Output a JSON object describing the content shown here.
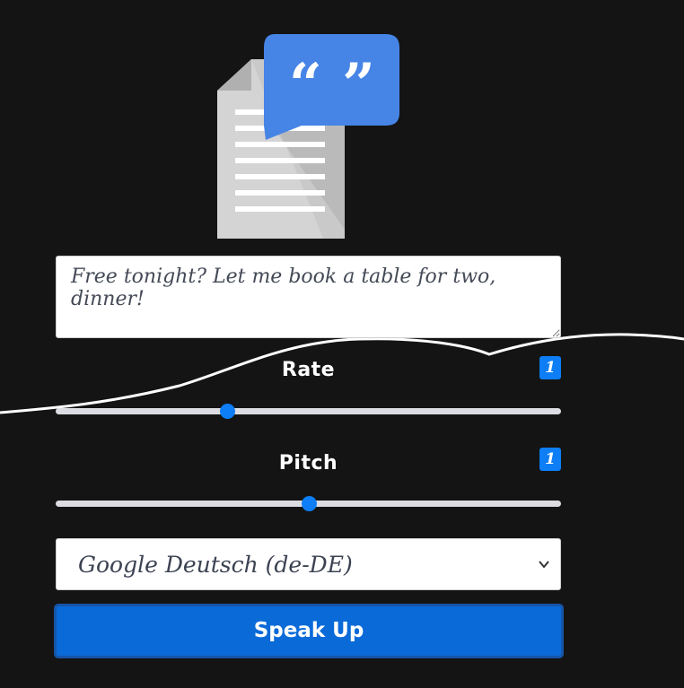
{
  "logo": {
    "icon": "text-to-speech-document-quote-icon",
    "quote_glyph": "“ ”"
  },
  "text_input": {
    "value": "Free tonight? Let me book a table for two, dinner!"
  },
  "rate": {
    "label": "Rate",
    "value": "1",
    "slider_fraction": 0.34
  },
  "pitch": {
    "label": "Pitch",
    "value": "1",
    "slider_fraction": 0.5
  },
  "voice_select": {
    "selected": "Google Deutsch (de-DE)"
  },
  "speak_button": {
    "label": "Speak Up"
  },
  "colors": {
    "accent": "#0d7ef5",
    "background": "#141414",
    "button": "#0a6ad8"
  }
}
